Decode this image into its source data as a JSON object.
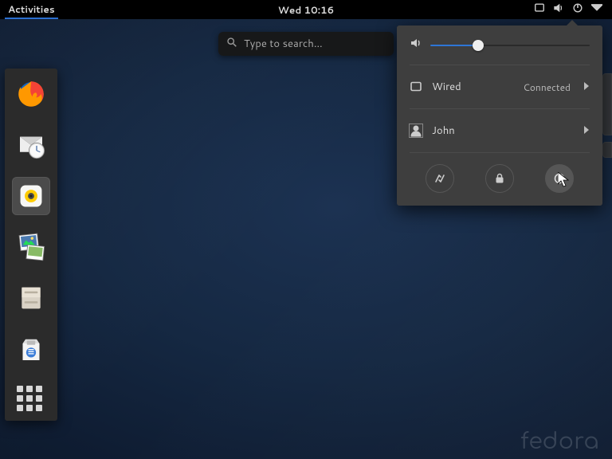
{
  "topbar": {
    "activities_label": "Activities",
    "clock": "Wed 10:16"
  },
  "search": {
    "placeholder": "Type to search..."
  },
  "dash": {
    "items": [
      {
        "name": "firefox"
      },
      {
        "name": "evolution-mail"
      },
      {
        "name": "rhythmbox"
      },
      {
        "name": "shotwell-photos"
      },
      {
        "name": "files"
      },
      {
        "name": "software"
      }
    ]
  },
  "system_menu": {
    "volume_percent": 30,
    "network": {
      "type_label": "Wired",
      "status": "Connected"
    },
    "user": {
      "name": "John"
    },
    "actions": {
      "settings": "settings",
      "lock": "lock",
      "power": "power"
    }
  },
  "watermark": "fedora"
}
